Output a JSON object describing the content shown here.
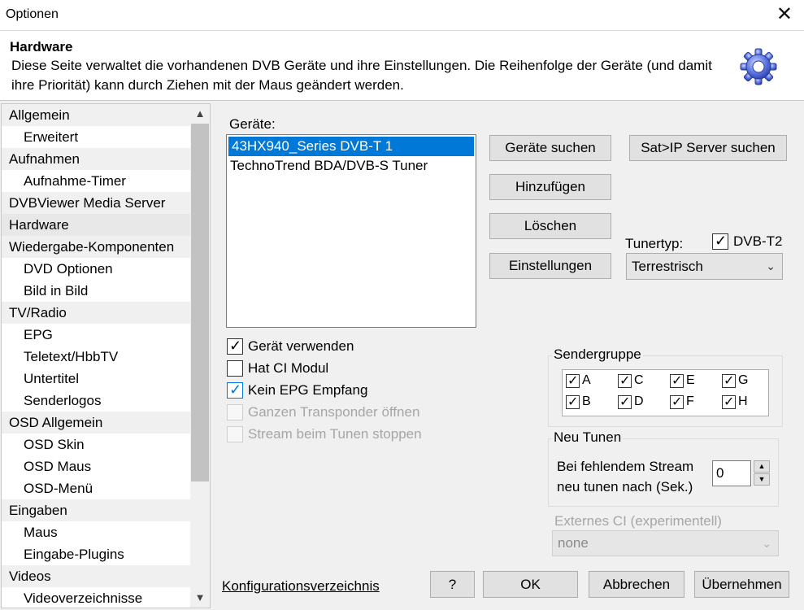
{
  "window": {
    "title": "Optionen",
    "close_glyph": "✕"
  },
  "header": {
    "title": "Hardware",
    "description": "Diese Seite verwaltet die vorhandenen DVB Geräte und ihre Einstellungen. Die Reihenfolge der Geräte (und damit ihre Priorität) kann durch Ziehen mit der Maus geändert werden.",
    "icon": "gear-icon"
  },
  "sidebar": {
    "items": [
      {
        "label": "Allgemein",
        "level": "top"
      },
      {
        "label": "Erweitert",
        "level": "sub"
      },
      {
        "label": "Aufnahmen",
        "level": "top"
      },
      {
        "label": "Aufnahme-Timer",
        "level": "sub"
      },
      {
        "label": "DVBViewer Media Server",
        "level": "top"
      },
      {
        "label": "Hardware",
        "level": "top",
        "selected": true
      },
      {
        "label": "Wiedergabe-Komponenten",
        "level": "top"
      },
      {
        "label": "DVD Optionen",
        "level": "sub"
      },
      {
        "label": "Bild in Bild",
        "level": "sub"
      },
      {
        "label": "TV/Radio",
        "level": "top"
      },
      {
        "label": "EPG",
        "level": "sub"
      },
      {
        "label": "Teletext/HbbTV",
        "level": "sub"
      },
      {
        "label": "Untertitel",
        "level": "sub"
      },
      {
        "label": "Senderlogos",
        "level": "sub"
      },
      {
        "label": "OSD Allgemein",
        "level": "top"
      },
      {
        "label": "OSD Skin",
        "level": "sub"
      },
      {
        "label": "OSD Maus",
        "level": "sub"
      },
      {
        "label": "OSD-Menü",
        "level": "sub"
      },
      {
        "label": "Eingaben",
        "level": "top"
      },
      {
        "label": "Maus",
        "level": "sub"
      },
      {
        "label": "Eingabe-Plugins",
        "level": "sub"
      },
      {
        "label": "Videos",
        "level": "top"
      },
      {
        "label": "Videoverzeichnisse",
        "level": "sub"
      }
    ],
    "scroll_up": "▲",
    "scroll_down": "▼"
  },
  "devices": {
    "label": "Geräte:",
    "list": [
      "43HX940_Series DVB-T 1",
      "TechnoTrend BDA/DVB-S Tuner"
    ]
  },
  "buttons": {
    "search_devices": "Geräte suchen",
    "search_satip": "Sat>IP Server suchen",
    "add": "Hinzufügen",
    "delete": "Löschen",
    "settings": "Einstellungen"
  },
  "tuner": {
    "label": "Tunertyp:",
    "value": "Terrestrisch",
    "dvbt2_label": "DVB-T2",
    "dvbt2_checked": true
  },
  "options": {
    "use_device": {
      "label": "Gerät verwenden",
      "checked": true
    },
    "has_ci": {
      "label": "Hat CI Modul",
      "checked": false
    },
    "no_epg": {
      "label": "Kein EPG Empfang",
      "checked": true
    },
    "whole_transponder": {
      "label": "Ganzen Transponder öffnen",
      "checked": false
    },
    "stop_stream": {
      "label": "Stream beim Tunen stoppen",
      "checked": false
    }
  },
  "sendergruppe": {
    "title": "Sendergruppe",
    "groups": [
      {
        "label": "A",
        "checked": true
      },
      {
        "label": "C",
        "checked": true
      },
      {
        "label": "E",
        "checked": true
      },
      {
        "label": "G",
        "checked": true
      },
      {
        "label": "B",
        "checked": true
      },
      {
        "label": "D",
        "checked": true
      },
      {
        "label": "F",
        "checked": true
      },
      {
        "label": "H",
        "checked": true
      }
    ]
  },
  "retune": {
    "title": "Neu Tunen",
    "line1": "Bei fehlendem Stream",
    "line2": "neu tunen nach (Sek.)",
    "value": "0"
  },
  "external_ci": {
    "label": "Externes CI (experimentell)",
    "value": "none"
  },
  "footer": {
    "config_link": "Konfigurationsverzeichnis",
    "help": "?",
    "ok": "OK",
    "cancel": "Abbrechen",
    "apply": "Übernehmen"
  }
}
